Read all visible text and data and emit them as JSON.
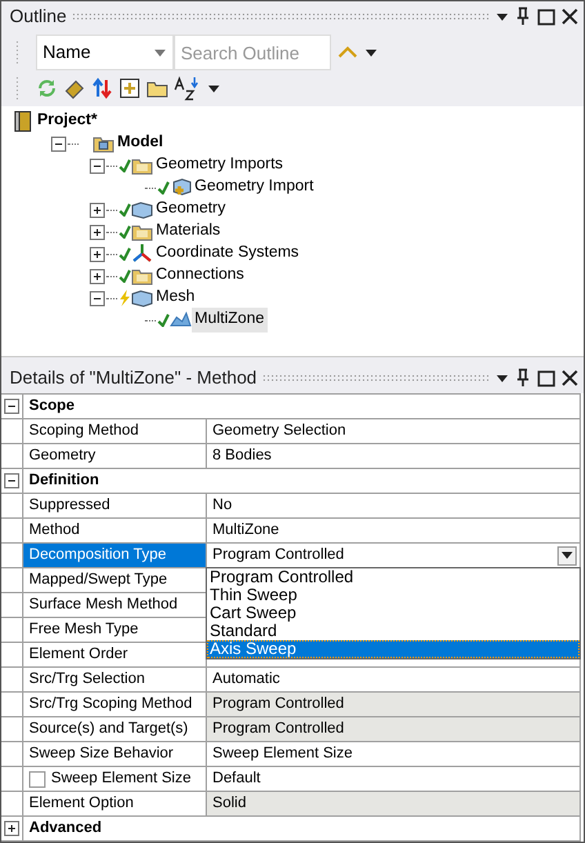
{
  "outline": {
    "title": "Outline",
    "filter": {
      "value": "Name"
    },
    "search": {
      "placeholder": "Search Outline"
    },
    "tree": [
      {
        "label": "Project*",
        "kind": "project",
        "selected": false,
        "children": [
          {
            "label": "Model",
            "kind": "model",
            "expanded": true,
            "selected": false,
            "children": [
              {
                "label": "Geometry Imports",
                "kind": "folder",
                "up_to_date": true,
                "expanded": true,
                "selected": false,
                "children": [
                  {
                    "label": "Geometry Import",
                    "kind": "import",
                    "up_to_date": true,
                    "selected": false
                  }
                ]
              },
              {
                "label": "Geometry",
                "kind": "part",
                "up_to_date": true,
                "expanded": false,
                "selected": false
              },
              {
                "label": "Materials",
                "kind": "folder",
                "up_to_date": true,
                "expanded": false,
                "selected": false
              },
              {
                "label": "Coordinate Systems",
                "kind": "axes",
                "up_to_date": true,
                "expanded": false,
                "selected": false
              },
              {
                "label": "Connections",
                "kind": "folder",
                "up_to_date": true,
                "expanded": false,
                "selected": false
              },
              {
                "label": "Mesh",
                "kind": "part",
                "up_to_date": false,
                "expanded": true,
                "selected": false,
                "children": [
                  {
                    "label": "MultiZone",
                    "kind": "mesh",
                    "up_to_date": true,
                    "selected": true
                  }
                ]
              }
            ]
          }
        ]
      }
    ]
  },
  "details": {
    "title": "Details of \"MultiZone\" - Method",
    "sections": [
      {
        "label": "Scope",
        "expanded": true,
        "rows": [
          {
            "label": "Scoping Method",
            "value": "Geometry Selection",
            "readonly": false,
            "selected": false
          },
          {
            "label": "Geometry",
            "value": "8 Bodies",
            "readonly": false,
            "selected": false
          }
        ]
      },
      {
        "label": "Definition",
        "expanded": true,
        "rows": [
          {
            "label": "Suppressed",
            "value": "No",
            "readonly": false,
            "selected": false
          },
          {
            "label": "Method",
            "value": "MultiZone",
            "readonly": false,
            "selected": false
          },
          {
            "label": "Decomposition Type",
            "value": "Program Controlled",
            "readonly": false,
            "selected": true,
            "kind": "combo"
          },
          {
            "label": "Mapped/Swept Type",
            "readonly": false,
            "selected": false
          },
          {
            "label": "Surface Mesh Method",
            "readonly": false,
            "selected": false
          },
          {
            "label": "Free Mesh Type",
            "readonly": false,
            "selected": false
          },
          {
            "label": "Element Order",
            "readonly": false,
            "selected": false
          },
          {
            "label": "Src/Trg Selection",
            "value": "Automatic",
            "readonly": false,
            "selected": false
          },
          {
            "label": "Src/Trg Scoping Method",
            "value": "Program Controlled",
            "readonly": true,
            "selected": false
          },
          {
            "label": "Source(s) and Target(s)",
            "value": "Program Controlled",
            "readonly": true,
            "selected": false
          },
          {
            "label": "Sweep Size Behavior",
            "value": "Sweep Element Size",
            "readonly": false,
            "selected": false
          },
          {
            "label": "Sweep Element Size",
            "value": "Default",
            "readonly": false,
            "selected": false,
            "kind": "checkbox",
            "checked": false
          },
          {
            "label": "Element Option",
            "value": "Solid",
            "readonly": true,
            "selected": false
          }
        ]
      },
      {
        "label": "Advanced",
        "expanded": false
      }
    ],
    "dropdown": {
      "items": [
        {
          "label": "Program Controlled",
          "selected": false
        },
        {
          "label": "Thin Sweep",
          "selected": false
        },
        {
          "label": "Cart Sweep",
          "selected": false
        },
        {
          "label": "Standard",
          "selected": false
        },
        {
          "label": "Axis Sweep",
          "selected": true
        }
      ]
    }
  }
}
